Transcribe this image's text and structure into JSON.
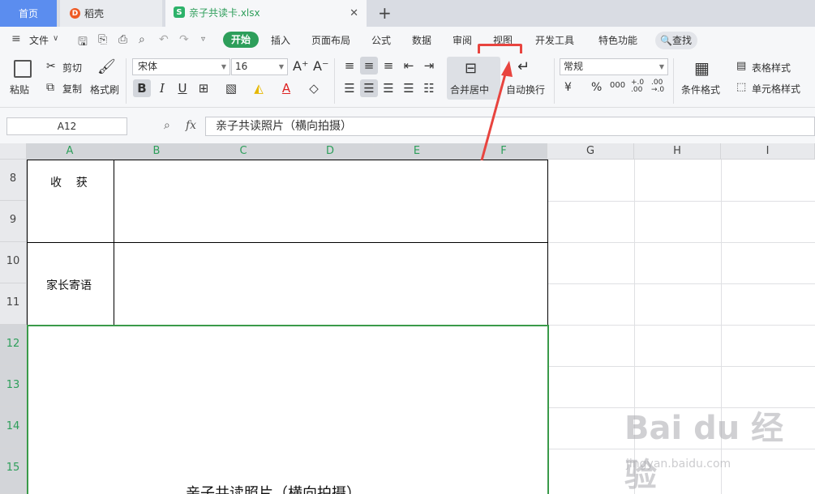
{
  "tabs": {
    "home": "首页",
    "daoke": "稻壳",
    "file": "亲子共读卡.xlsx",
    "daoke_logo": "D",
    "file_logo": "S"
  },
  "menu": {
    "file": "文件",
    "start": "开始",
    "insert": "插入",
    "page_layout": "页面布局",
    "formula": "公式",
    "data": "数据",
    "review": "审阅",
    "view": "视图",
    "developer": "开发工具",
    "special": "特色功能",
    "search": "查找"
  },
  "ribbon": {
    "paste": "粘贴",
    "cut": "剪切",
    "copy": "复制",
    "format_painter": "格式刷",
    "font_name": "宋体",
    "font_size": "16",
    "merge_center": "合并居中",
    "auto_wrap": "自动换行",
    "number_format": "常规",
    "conditional_format": "条件格式",
    "table_style": "表格样式",
    "cell_style": "单元格样式",
    "bold": "B",
    "italic": "I",
    "underline": "U",
    "currency": "¥",
    "percent": "%",
    "thousands": "000",
    "inc_dec": "+.0\n.00",
    "dec_dec": ".00\n→.0"
  },
  "formula_bar": {
    "name_box": "A12",
    "fx": "fx",
    "content": "亲子共读照片（横向拍摄）"
  },
  "columns": [
    "A",
    "B",
    "C",
    "D",
    "E",
    "F",
    "G",
    "H",
    "I"
  ],
  "rows": [
    "8",
    "9",
    "10",
    "11",
    "12",
    "13",
    "14",
    "15"
  ],
  "cells": {
    "harvest": "收    获",
    "parent_note": "家长寄语",
    "photo_title": "亲子共读照片（横向拍摄）"
  },
  "watermark": {
    "main": "Bai du 经验",
    "sub": "jingyan.baidu.com"
  },
  "colors": {
    "accent": "#2d9e5a",
    "highlight": "#e8443f",
    "tab_home": "#5b8def"
  }
}
